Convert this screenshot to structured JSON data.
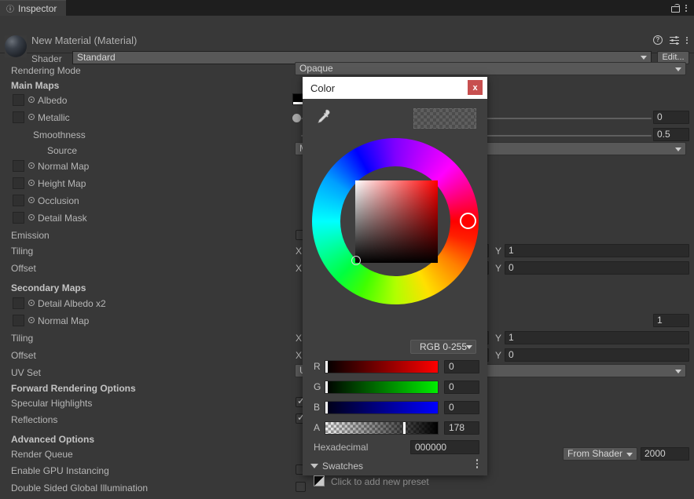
{
  "tab": {
    "label": "Inspector",
    "icon": "info-icon"
  },
  "header": {
    "title": "New Material (Material)",
    "shader_label": "Shader",
    "shader_value": "Standard",
    "edit_label": "Edit...",
    "lock_icon": "lock-icon",
    "menu_icon": "kebab-menu-icon",
    "help_icon": "help-icon",
    "preset_icon": "preset-icon"
  },
  "inspector": {
    "rows": [
      {
        "label": "Rendering Mode"
      },
      {
        "label": "Main Maps"
      },
      {
        "label": "Albedo"
      },
      {
        "label": "Metallic"
      },
      {
        "label": "Smoothness"
      },
      {
        "label": "Source"
      },
      {
        "label": "Normal Map"
      },
      {
        "label": "Height Map"
      },
      {
        "label": "Occlusion"
      },
      {
        "label": "Detail Mask"
      },
      {
        "label": "Emission"
      },
      {
        "label": "Tiling"
      },
      {
        "label": "Offset"
      },
      {
        "label": "Secondary Maps"
      },
      {
        "label": "Detail Albedo x2"
      },
      {
        "label": "Normal Map"
      },
      {
        "label": "Tiling"
      },
      {
        "label": "Offset"
      },
      {
        "label": "UV Set"
      },
      {
        "label": "Forward Rendering Options"
      },
      {
        "label": "Specular Highlights"
      },
      {
        "label": "Reflections"
      },
      {
        "label": "Advanced Options"
      },
      {
        "label": "Render Queue"
      },
      {
        "label": "Enable GPU Instancing"
      },
      {
        "label": "Double Sided Global Illumination"
      }
    ],
    "rendering_mode_value": "Opaque",
    "metallic_value": "0",
    "smoothness_value": "0.5",
    "smoothness_source_value": "M",
    "main_tiling": {
      "x_label": "X",
      "x_value": "",
      "y_label": "Y",
      "y_value": "1"
    },
    "main_offset": {
      "x_label": "X",
      "x_value": "",
      "y_label": "Y",
      "y_value": "0"
    },
    "detail_scale_value": "1",
    "secondary_tiling": {
      "x_label": "X",
      "x_value": "",
      "y_label": "Y",
      "y_value": "1"
    },
    "secondary_offset": {
      "x_label": "X",
      "x_value": "",
      "y_label": "Y",
      "y_value": "0"
    },
    "uv_set_value": "U",
    "render_queue_mode": "From Shader",
    "render_queue_value": "2000"
  },
  "picker": {
    "title": "Color",
    "close_label": "x",
    "eyedropper_icon": "eyedropper-icon",
    "mode_label": "RGB 0-255",
    "channels": [
      {
        "name": "R",
        "value": "0",
        "pos_pct": 0
      },
      {
        "name": "G",
        "value": "0",
        "pos_pct": 0
      },
      {
        "name": "B",
        "value": "0",
        "pos_pct": 0
      },
      {
        "name": "A",
        "value": "178",
        "pos_pct": 69.8
      }
    ],
    "hex_label": "Hexadecimal",
    "hex_value": "000000",
    "swatches_label": "Swatches",
    "swatches_hint": "Click to add new preset",
    "swatches_menu_icon": "kebab-menu-icon"
  },
  "colors": {
    "panel_bg": "#383838",
    "dialog_bg": "#3f3f3f",
    "titlebar_bg": "#ffffff",
    "close_red": "#c74f4f",
    "hue_marker": "#ff0000"
  }
}
